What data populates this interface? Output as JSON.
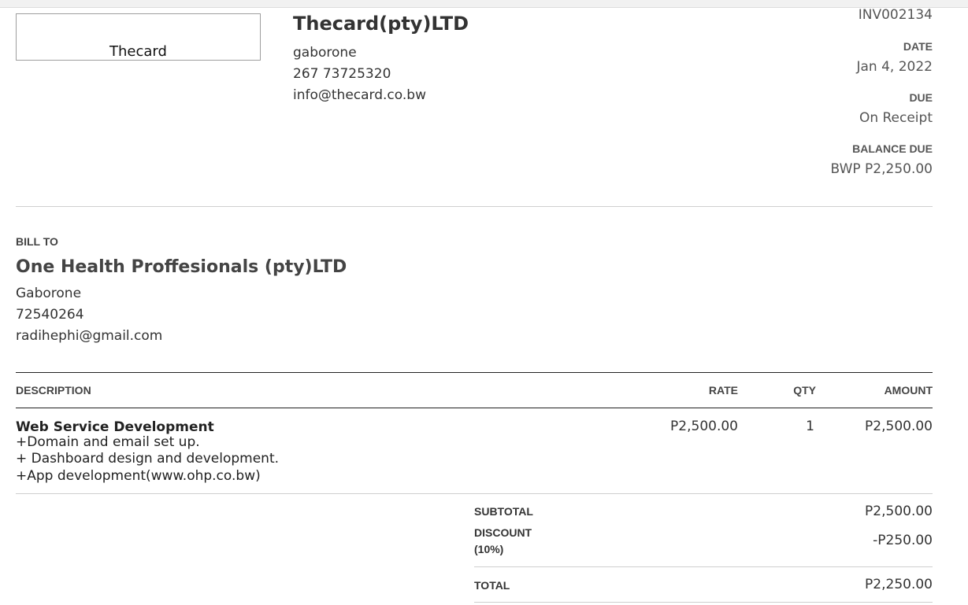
{
  "company": {
    "logo_text": "Thecard",
    "name": "Thecard(pty)LTD",
    "city": "gaborone",
    "phone": "267 73725320",
    "email": "info@thecard.co.bw"
  },
  "invoice": {
    "number": "INV002134",
    "date_label": "DATE",
    "date": "Jan 4, 2022",
    "due_label": "DUE",
    "due": "On Receipt",
    "balance_label": "BALANCE DUE",
    "balance": "BWP P2,250.00"
  },
  "bill_to": {
    "label": "BILL TO",
    "name": "One Health Proffesionals (pty)LTD",
    "city": "Gaborone",
    "phone": "72540264",
    "email": "radihephi@gmail.com"
  },
  "table": {
    "headers": {
      "description": "DESCRIPTION",
      "rate": "RATE",
      "qty": "QTY",
      "amount": "AMOUNT"
    },
    "items": [
      {
        "title": "Web Service Development",
        "details": [
          "+Domain and email set up.",
          "+ Dashboard design and development.",
          "+App development(www.ohp.co.bw)"
        ],
        "rate": "P2,500.00",
        "qty": "1",
        "amount": "P2,500.00"
      }
    ]
  },
  "totals": {
    "subtotal_label": "SUBTOTAL",
    "subtotal": "P2,500.00",
    "discount_label_1": "DISCOUNT",
    "discount_label_2": "(10%)",
    "discount": "-P250.00",
    "total_label": "TOTAL",
    "total": "P2,250.00"
  }
}
